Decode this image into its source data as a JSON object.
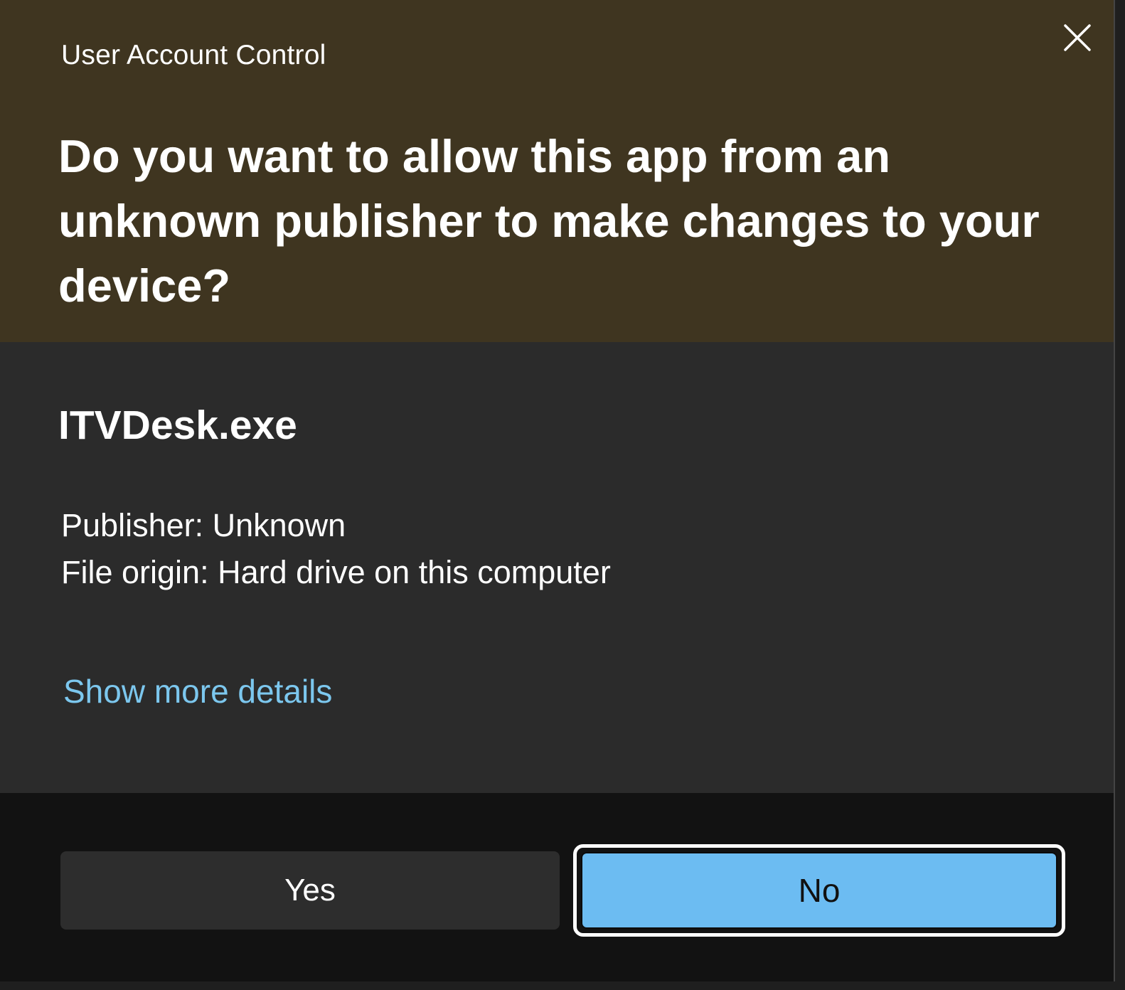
{
  "window": {
    "title": "User Account Control",
    "close_icon": "close-icon"
  },
  "header": {
    "question": "Do you want to allow this app from an unknown publisher to make changes to your device?"
  },
  "app": {
    "name": "ITVDesk.exe",
    "publisher": "Publisher: Unknown",
    "file_origin": "File origin: Hard drive on this computer",
    "more_details_link": "Show more details"
  },
  "buttons": {
    "yes": "Yes",
    "no": "No"
  },
  "colors": {
    "header_bg": "#3f3520",
    "body_bg": "#2b2b2b",
    "footer_bg": "#121212",
    "link": "#7cc7ee",
    "primary_button": "#6cbcf2"
  }
}
